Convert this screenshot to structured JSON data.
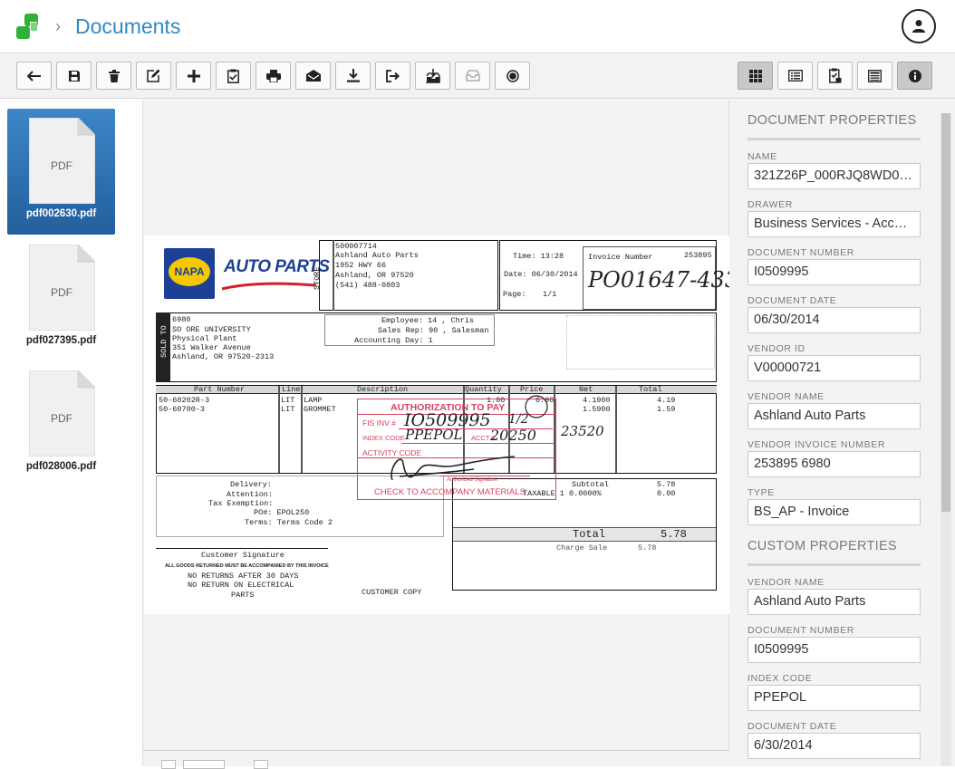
{
  "header": {
    "breadcrumb_title": "Documents"
  },
  "toolbar": {
    "left_buttons": [
      "back-icon",
      "save-icon",
      "trash-icon",
      "edit-icon",
      "add-icon",
      "clipboard-check-icon",
      "print-icon",
      "email-icon",
      "download-icon",
      "export-icon",
      "inbox-in-icon",
      "inbox-icon",
      "record-icon"
    ],
    "right_buttons": [
      "grid-view-icon",
      "list-view-icon",
      "clipboard-view-icon",
      "form-view-icon",
      "info-icon"
    ]
  },
  "thumbnails": [
    {
      "type_label": "PDF",
      "filename": "pdf002630.pdf"
    },
    {
      "type_label": "PDF",
      "filename": "pdf027395.pdf"
    },
    {
      "type_label": "PDF",
      "filename": "pdf028006.pdf"
    }
  ],
  "document": {
    "store": {
      "id": "500007714",
      "name": "Ashland Auto Parts",
      "address1": "1952 HWY 66",
      "address2": "Ashland, OR 97520",
      "phone": "(541) 488-0803",
      "store_label": "STORE"
    },
    "logo": {
      "brand": "NAPA",
      "auto_parts": "AUTO PARTS"
    },
    "time": "Time: 13:28",
    "date": "Date: 06/30/2014",
    "page": "Page:",
    "page_num": "1/1",
    "invoice_number_label": "Invoice Number",
    "invoice_number_value": "253895",
    "handwritten_invoice": "PO01647-433",
    "sold_to_label": "SOLD TO",
    "sold_to": [
      "6980",
      "SO ORE UNIVERSITY",
      "Physical Plant",
      "351 Walker Avenue",
      "Ashland, OR 97520-2313"
    ],
    "employee": "Employee: 14 , Chris",
    "sales_rep": "Sales Rep: 90 , Salesman",
    "accounting_day": "Accounting Day: 1",
    "columns": [
      "Part Number",
      "Line",
      "Description",
      "Quantity",
      "Price",
      "Net",
      "Total"
    ],
    "rows": [
      [
        "50-60202R-3",
        "LIT",
        "LAMP",
        "1.00",
        "6.98",
        "4.1900",
        "4.19"
      ],
      [
        "50-60700-3",
        "LIT",
        "GROMMET",
        "",
        "",
        "1.5900",
        "1.59"
      ]
    ],
    "stamp": {
      "title": "AUTHORIZATION TO PAY",
      "fis": "FIS INV #",
      "index_code": "INDEX CODE",
      "acct": "ACCT #",
      "activity_code": "ACTIVITY CODE",
      "auth_sig": "Authorized Signature",
      "check_note": "CHECK TO ACCOMPANY MATERIALS",
      "hand_fis": "IO509995",
      "hand_index": "PPEPOL",
      "hand_acct": "20250",
      "hand_side": "23520",
      "hand_frac": "1/2"
    },
    "delivery": "Delivery:",
    "attention": "Attention:",
    "tax_exemption": "Tax Exemption:",
    "po": "PO#: EPOL250",
    "terms": "Terms:  Terms Code 2",
    "subtotal_label": "Subtotal",
    "subtotal_value": "5.78",
    "taxable_label": "TAXABLE 1 0.0000%",
    "taxable_value": "0.00",
    "total_label": "Total",
    "total_value": "5.78",
    "charge_sale_label": "Charge Sale",
    "charge_sale_value": "5.78",
    "customer_signature": "Customer Signature",
    "returns_note": "ALL GOODS RETURNED MUST BE ACCOMPANIED BY THIS INVOICE",
    "no_returns": "NO RETURNS AFTER 30 DAYS",
    "no_return_elec": "NO RETURN ON ELECTRICAL",
    "parts": "PARTS",
    "customer_copy": "CUSTOMER COPY"
  },
  "properties": {
    "document_title": "DOCUMENT PROPERTIES",
    "document_fields": [
      {
        "label": "NAME",
        "value": "321Z26P_000RJQ8WD00..."
      },
      {
        "label": "DRAWER",
        "value": "Business Services - Accou..."
      },
      {
        "label": "DOCUMENT NUMBER",
        "value": "I0509995"
      },
      {
        "label": "DOCUMENT DATE",
        "value": "06/30/2014"
      },
      {
        "label": "VENDOR ID",
        "value": "V00000721"
      },
      {
        "label": "VENDOR NAME",
        "value": "Ashland Auto Parts"
      },
      {
        "label": "VENDOR INVOICE NUMBER",
        "value": "253895 6980"
      },
      {
        "label": "TYPE",
        "value": "BS_AP - Invoice"
      }
    ],
    "custom_title": "CUSTOM PROPERTIES",
    "custom_fields": [
      {
        "label": "VENDOR NAME",
        "value": "Ashland Auto Parts"
      },
      {
        "label": "DOCUMENT NUMBER",
        "value": "I0509995"
      },
      {
        "label": "INDEX CODE",
        "value": "PPEPOL"
      },
      {
        "label": "DOCUMENT DATE",
        "value": "6/30/2014"
      }
    ]
  },
  "colors": {
    "accent": "#3289c3",
    "logo_green": "#2eb135",
    "selected_thumb": "#2a6fb0",
    "stamp_red": "#d8435f"
  }
}
